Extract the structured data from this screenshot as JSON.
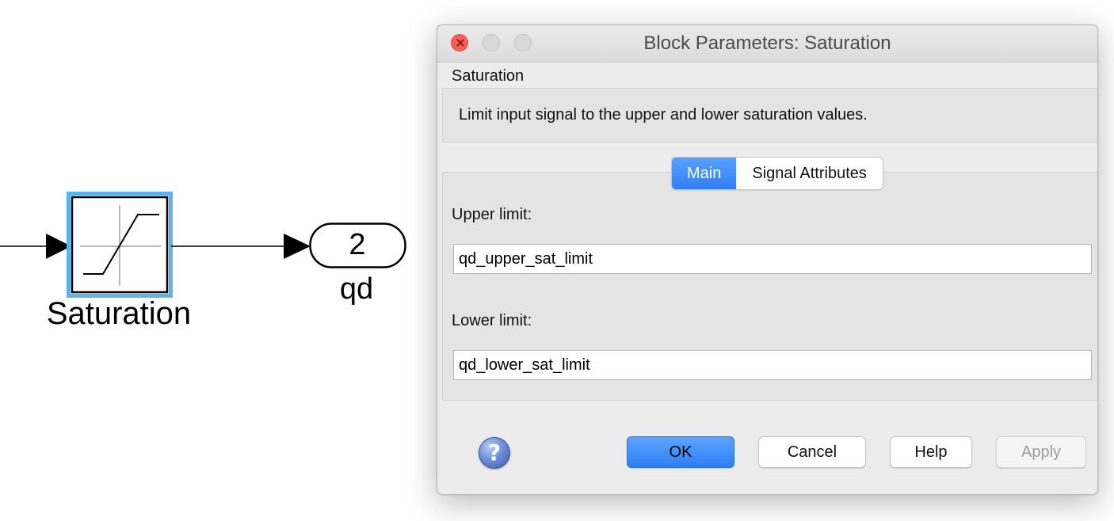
{
  "canvas": {
    "saturation_block_label": "Saturation",
    "outport_number": "2",
    "outport_label": "qd"
  },
  "dialog": {
    "title": "Block Parameters: Saturation",
    "block_type": "Saturation",
    "description": "Limit input signal to the upper and lower saturation values.",
    "tabs": [
      {
        "label": "Main",
        "active": true
      },
      {
        "label": "Signal Attributes",
        "active": false
      }
    ],
    "upper_limit_label": "Upper limit:",
    "upper_limit_value": "qd_upper_sat_limit",
    "lower_limit_label": "Lower limit:",
    "lower_limit_value": "qd_lower_sat_limit",
    "help_icon_glyph": "?",
    "buttons": {
      "ok": "OK",
      "cancel": "Cancel",
      "help": "Help",
      "apply": "Apply"
    }
  },
  "colors": {
    "selection_highlight": "#5ab4ec",
    "primary_button": "#2f7ff6",
    "close_button": "#fc5f57"
  }
}
